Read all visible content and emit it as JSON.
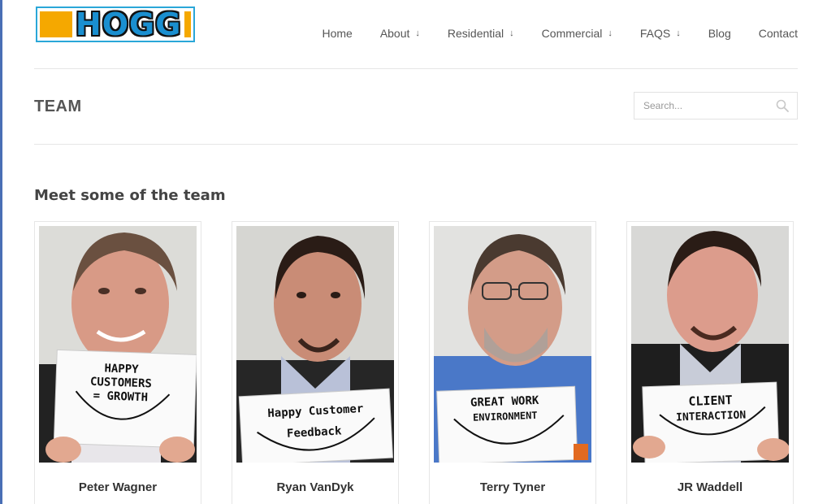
{
  "logo": {
    "text": "HOGG"
  },
  "nav": [
    {
      "label": "Home",
      "has_dropdown": false
    },
    {
      "label": "About",
      "has_dropdown": true
    },
    {
      "label": "Residential",
      "has_dropdown": true
    },
    {
      "label": "Commercial",
      "has_dropdown": true
    },
    {
      "label": "FAQS",
      "has_dropdown": true
    },
    {
      "label": "Blog",
      "has_dropdown": false
    },
    {
      "label": "Contact",
      "has_dropdown": false
    }
  ],
  "dropdown_glyph": "↓",
  "page": {
    "title": "TEAM"
  },
  "search": {
    "placeholder": "Search..."
  },
  "section": {
    "heading": "Meet some of the team"
  },
  "team": [
    {
      "name": "Peter Wagner",
      "sign_lines": [
        "HAPPY",
        "CUSTOMERS",
        "= GROWTH"
      ]
    },
    {
      "name": "Ryan VanDyk",
      "sign_lines": [
        "Happy Customer",
        "Feedback"
      ]
    },
    {
      "name": "Terry Tyner",
      "sign_lines": [
        "GREAT WORK",
        "ENVIRONMENT"
      ]
    },
    {
      "name": "JR Waddell",
      "sign_lines": [
        "CLIENT",
        "INTERACTION"
      ]
    }
  ],
  "colors": {
    "accent": "#e8a93a",
    "logo_blue": "#1a8fd0",
    "logo_orange": "#f5a800"
  }
}
